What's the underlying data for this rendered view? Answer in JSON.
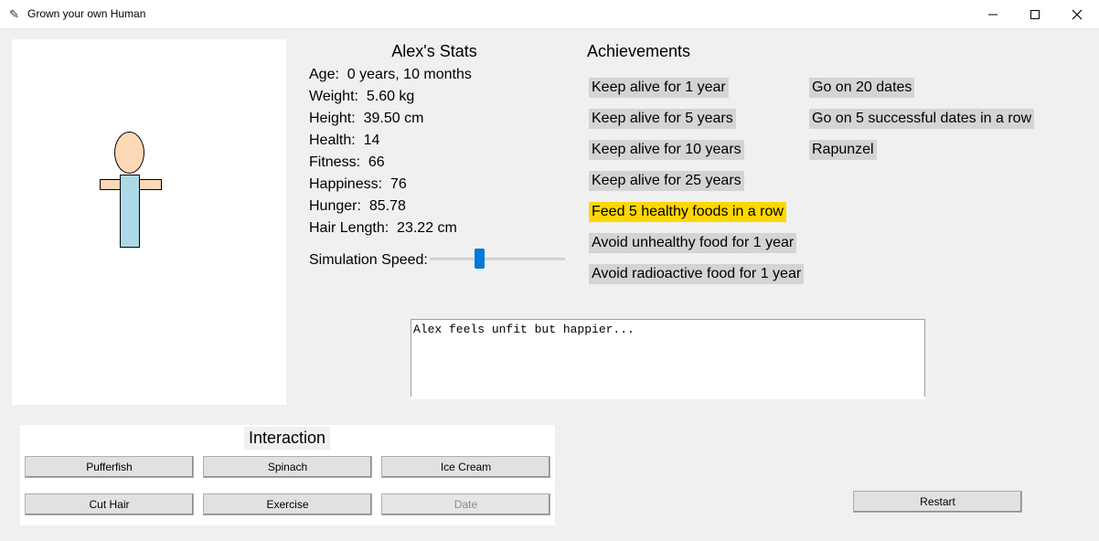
{
  "window": {
    "title": "Grown your own Human",
    "controls": {
      "minimize": "—",
      "maximize": "☐",
      "close": "✕"
    },
    "app_icon": "feather-icon"
  },
  "character": {
    "colors": {
      "skin": "#fdd8b5",
      "shirt": "#add8e6"
    }
  },
  "stats": {
    "title": "Alex's Stats",
    "rows": [
      "Age:  0 years, 10 months",
      "Weight:  5.60 kg",
      "Height:  39.50 cm",
      "Health:  14",
      "Fitness:  66",
      "Happiness:  76",
      "Hunger:  85.78",
      "Hair Length:  23.22 cm"
    ],
    "speed_label": "Simulation Speed:",
    "speed_value_fraction": 0.36
  },
  "achievements": {
    "title": "Achievements",
    "items": [
      {
        "label": "Keep alive for 1 year",
        "unlocked": false
      },
      {
        "label": "Keep alive for 5 years",
        "unlocked": false
      },
      {
        "label": "Keep alive for 10 years",
        "unlocked": false
      },
      {
        "label": "Keep alive for 25 years",
        "unlocked": false
      },
      {
        "label": "Feed 5 healthy foods in a row",
        "unlocked": true
      },
      {
        "label": "Avoid unhealthy food for 1 year",
        "unlocked": false
      },
      {
        "label": "Avoid radioactive food for 1 year",
        "unlocked": false
      },
      {
        "label": "Go on 20 dates",
        "unlocked": false
      },
      {
        "label": "Go on 5 successful dates in a row",
        "unlocked": false
      },
      {
        "label": "Rapunzel",
        "unlocked": false
      }
    ],
    "colors": {
      "locked": "#d4d4d4",
      "unlocked": "#ffd700"
    }
  },
  "log": {
    "text": "Alex feels unfit but happier..."
  },
  "interaction": {
    "title": "Interaction",
    "buttons": [
      {
        "label": "Pufferfish",
        "enabled": true
      },
      {
        "label": "Spinach",
        "enabled": true
      },
      {
        "label": "Ice Cream",
        "enabled": true
      },
      {
        "label": "Cut Hair",
        "enabled": true
      },
      {
        "label": "Exercise",
        "enabled": true
      },
      {
        "label": "Date",
        "enabled": false
      }
    ]
  },
  "restart": {
    "label": "Restart"
  }
}
